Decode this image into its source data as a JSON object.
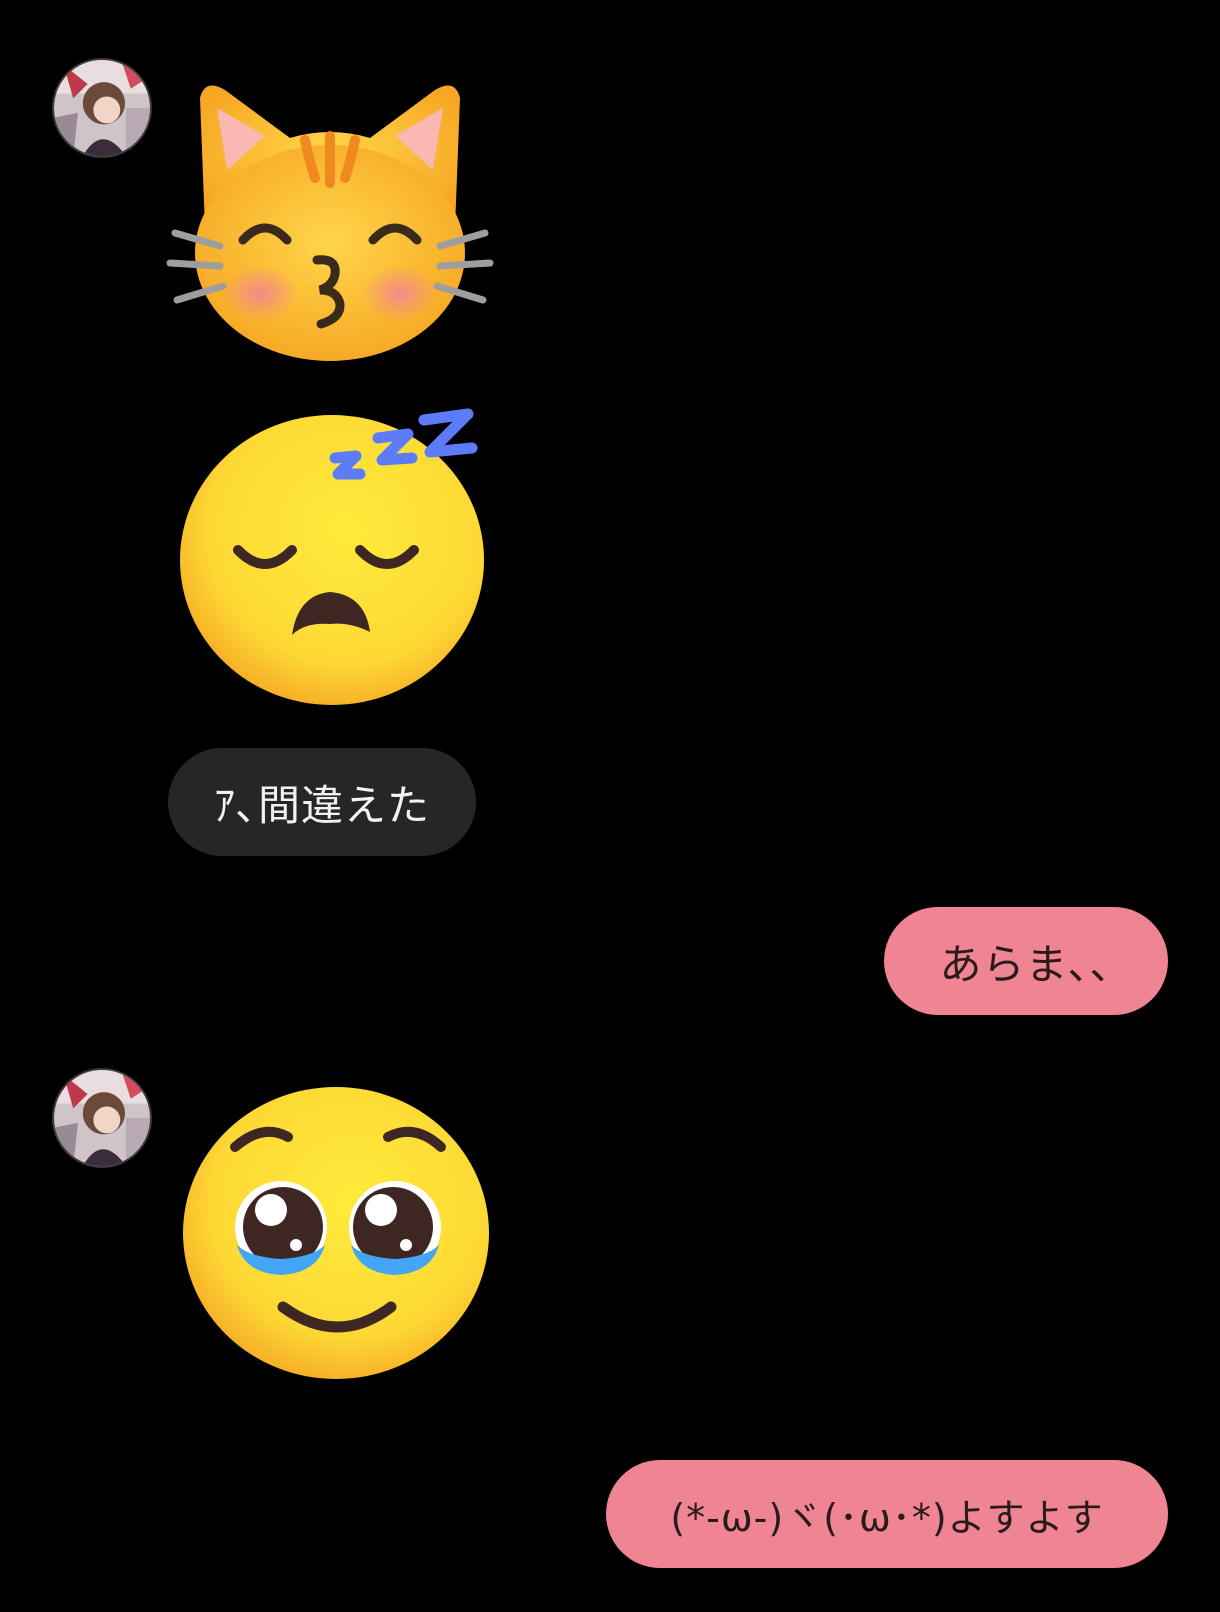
{
  "colors": {
    "background": "#000000",
    "incoming_bubble": "#262626",
    "outgoing_bubble": "#ef8593",
    "incoming_text": "#f2f2f2",
    "outgoing_text": "#2a1a1c"
  },
  "messages": [
    {
      "sender": "contact",
      "type": "emoji",
      "icon": "kissing-cat-icon"
    },
    {
      "sender": "contact",
      "type": "emoji",
      "icon": "sleeping-face-icon"
    },
    {
      "sender": "contact",
      "type": "text",
      "text": "ｱ､間違えた"
    },
    {
      "sender": "me",
      "type": "text",
      "text": "あらま､､"
    },
    {
      "sender": "contact",
      "type": "emoji",
      "icon": "pleading-face-icon"
    },
    {
      "sender": "me",
      "type": "text",
      "text": "(*-ω-)ヾ(･ω･*)よすよす"
    }
  ]
}
